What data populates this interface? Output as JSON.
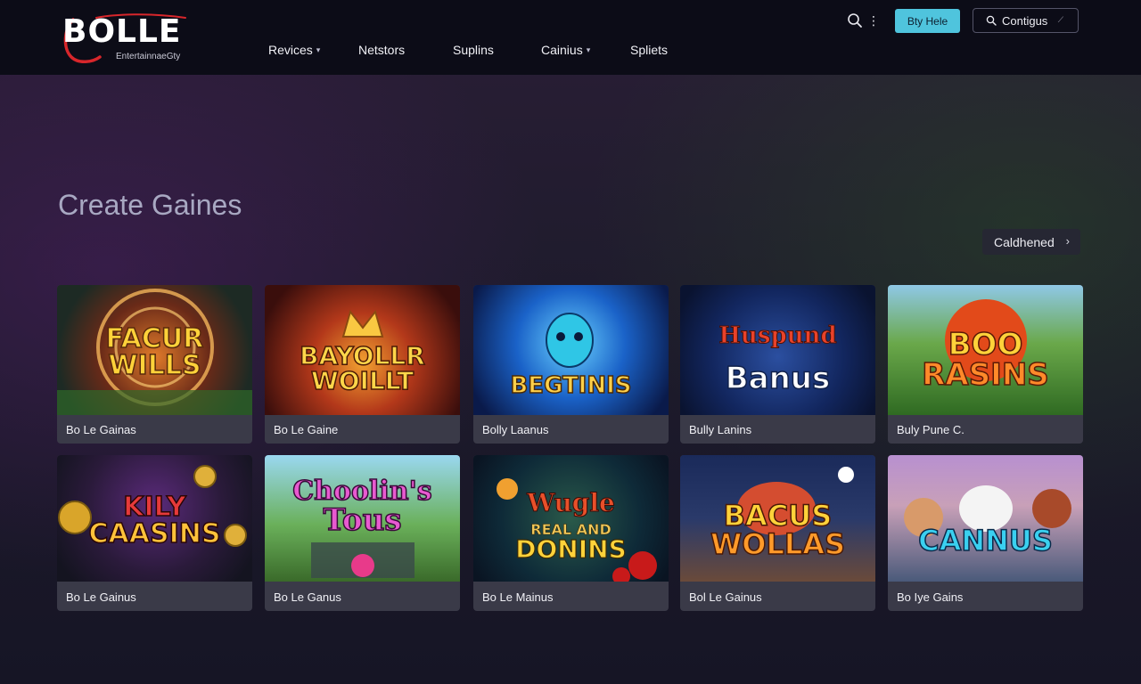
{
  "brand": {
    "name": "BOLLE",
    "tagline": "EntertainnaeGty"
  },
  "nav": {
    "items": [
      {
        "label": "Revices",
        "has_dropdown": true
      },
      {
        "label": "Netstors",
        "has_dropdown": false
      },
      {
        "label": "Suplins",
        "has_dropdown": false
      },
      {
        "label": "Cainius",
        "has_dropdown": true
      },
      {
        "label": "Spliets",
        "has_dropdown": false
      }
    ]
  },
  "header_actions": {
    "primary_button": "Bty Hele",
    "secondary_button": "Contigus"
  },
  "section": {
    "title": "Create Gaines",
    "filter_label": "Caldhened"
  },
  "games": [
    {
      "art_title": [
        "FACUR",
        "WILLS"
      ],
      "label": "Bo Le Gainas"
    },
    {
      "art_title": [
        "BAYOLLR",
        "WOILLT"
      ],
      "label": "Bo Le Gaine"
    },
    {
      "art_title": [
        "BEGTINIS"
      ],
      "label": "Bolly Laanus"
    },
    {
      "art_title": [
        "Huspund",
        "Banus"
      ],
      "label": "Bully Lanins"
    },
    {
      "art_title": [
        "BOO",
        "RASINS"
      ],
      "label": "Buly Pune C."
    },
    {
      "art_title": [
        "KILY",
        "CAASINS"
      ],
      "label": "Bo Le Gainus"
    },
    {
      "art_title": [
        "Choolin's",
        "Tous"
      ],
      "label": "Bo Le Ganus"
    },
    {
      "art_title": [
        "Wugle",
        "REAL AND",
        "DONINS"
      ],
      "label": "Bo Le Mainus"
    },
    {
      "art_title": [
        "BACUS",
        "WOLLAS"
      ],
      "label": "Bol Le Gainus"
    },
    {
      "art_title": [
        "CANNUS"
      ],
      "label": "Bo Iye Gains"
    }
  ],
  "colors": {
    "header_bg": "#0c0c17",
    "accent_cyan": "#4fc4dd",
    "logo_red": "#d8262b",
    "card_footer": "#3a3a48"
  },
  "icons": [
    "search-icon",
    "more-vertical-icon",
    "chevron-right-icon",
    "chevron-down-icon"
  ]
}
